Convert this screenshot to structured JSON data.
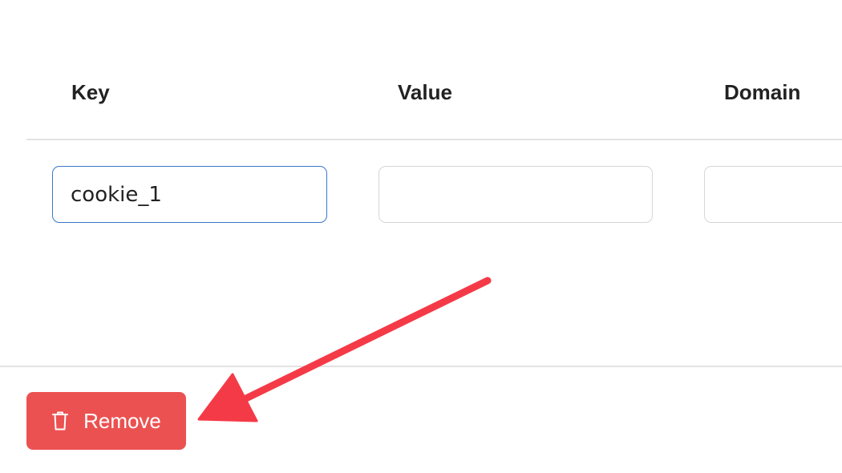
{
  "table": {
    "headers": {
      "key": "Key",
      "value": "Value",
      "domain": "Domain"
    },
    "row": {
      "key": "cookie_1",
      "value": "",
      "domain": ""
    }
  },
  "footer": {
    "remove_label": "Remove",
    "remove_icon": "trash-icon"
  },
  "colors": {
    "accent_danger": "#ec5151",
    "focus_border": "#3a78c9",
    "annotation_arrow": "#f53a47"
  }
}
